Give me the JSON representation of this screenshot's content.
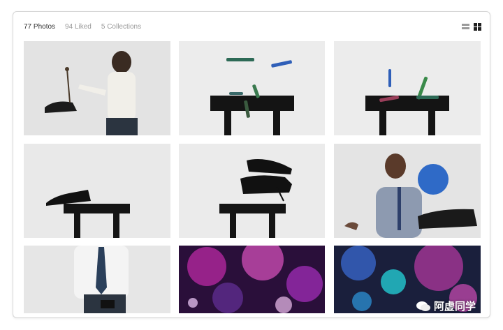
{
  "tabs": [
    {
      "label": "77 Photos",
      "active": true
    },
    {
      "label": "94 Liked",
      "active": false
    },
    {
      "label": "5 Collections",
      "active": false
    }
  ],
  "view_toggle": {
    "list_icon": "list-view-icon",
    "grid_icon": "grid-view-icon",
    "selected": "grid"
  },
  "photos": [
    {
      "subject": "man-holding-shoe",
      "bg": "#e6e6e6"
    },
    {
      "subject": "floating-markers-stool",
      "bg": "#ececec"
    },
    {
      "subject": "markers-on-stool",
      "bg": "#ececec"
    },
    {
      "subject": "shoe-on-stool",
      "bg": "#e9e9e9"
    },
    {
      "subject": "floating-shoes-stool",
      "bg": "#ebebeb"
    },
    {
      "subject": "man-blue-ball-shoe",
      "bg": "#e4e4e4"
    },
    {
      "subject": "man-tie-partial",
      "bg": "#e6e6e6"
    },
    {
      "subject": "purple-neon-abstract",
      "bg": "#3a1a4a"
    },
    {
      "subject": "teal-purple-abstract",
      "bg": "#1a2a4a"
    }
  ],
  "watermark": {
    "text": "阿虚同学",
    "icon": "wechat-icon"
  },
  "colors": {
    "active_tab": "#333333",
    "inactive_tab": "#9a9a9a",
    "border": "#d6d6d6"
  }
}
